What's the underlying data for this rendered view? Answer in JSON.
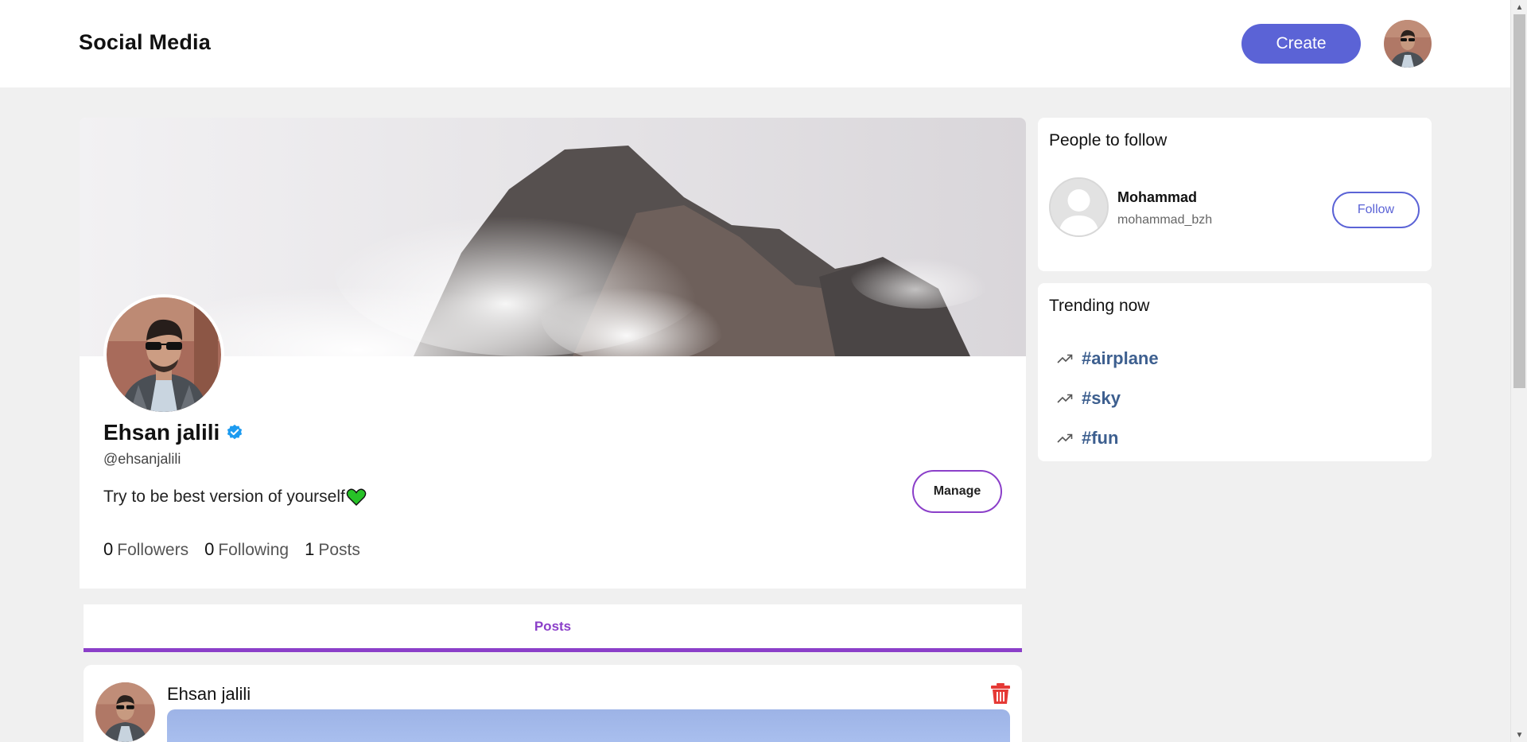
{
  "header": {
    "brand": "Social Media",
    "create_label": "Create"
  },
  "profile": {
    "name": "Ehsan jalili",
    "handle": "@ehsanjalili",
    "bio": "Try to be best version of yourself",
    "manage_label": "Manage",
    "stats": {
      "followers_count": "0",
      "followers_label": "Followers",
      "following_count": "0",
      "following_label": "Following",
      "posts_count": "1",
      "posts_label": "Posts"
    }
  },
  "tabs": {
    "posts_label": "Posts"
  },
  "post": {
    "author": "Ehsan jalili"
  },
  "people_to_follow": {
    "title": "People to follow",
    "items": [
      {
        "name": "Mohammad",
        "handle": "mohammad_bzh",
        "follow_label": "Follow"
      }
    ]
  },
  "trending": {
    "title": "Trending now",
    "tags": [
      "#airplane",
      "#sky",
      "#fun"
    ]
  },
  "colors": {
    "accent": "#5b63d6",
    "purple": "#8b3fc9",
    "verified": "#1d9bf0",
    "delete": "#e53935",
    "trend_link": "#3d5f8f"
  },
  "icons": [
    "verified-icon",
    "heart-icon",
    "delete-icon",
    "trending-icon",
    "default-avatar-icon"
  ]
}
